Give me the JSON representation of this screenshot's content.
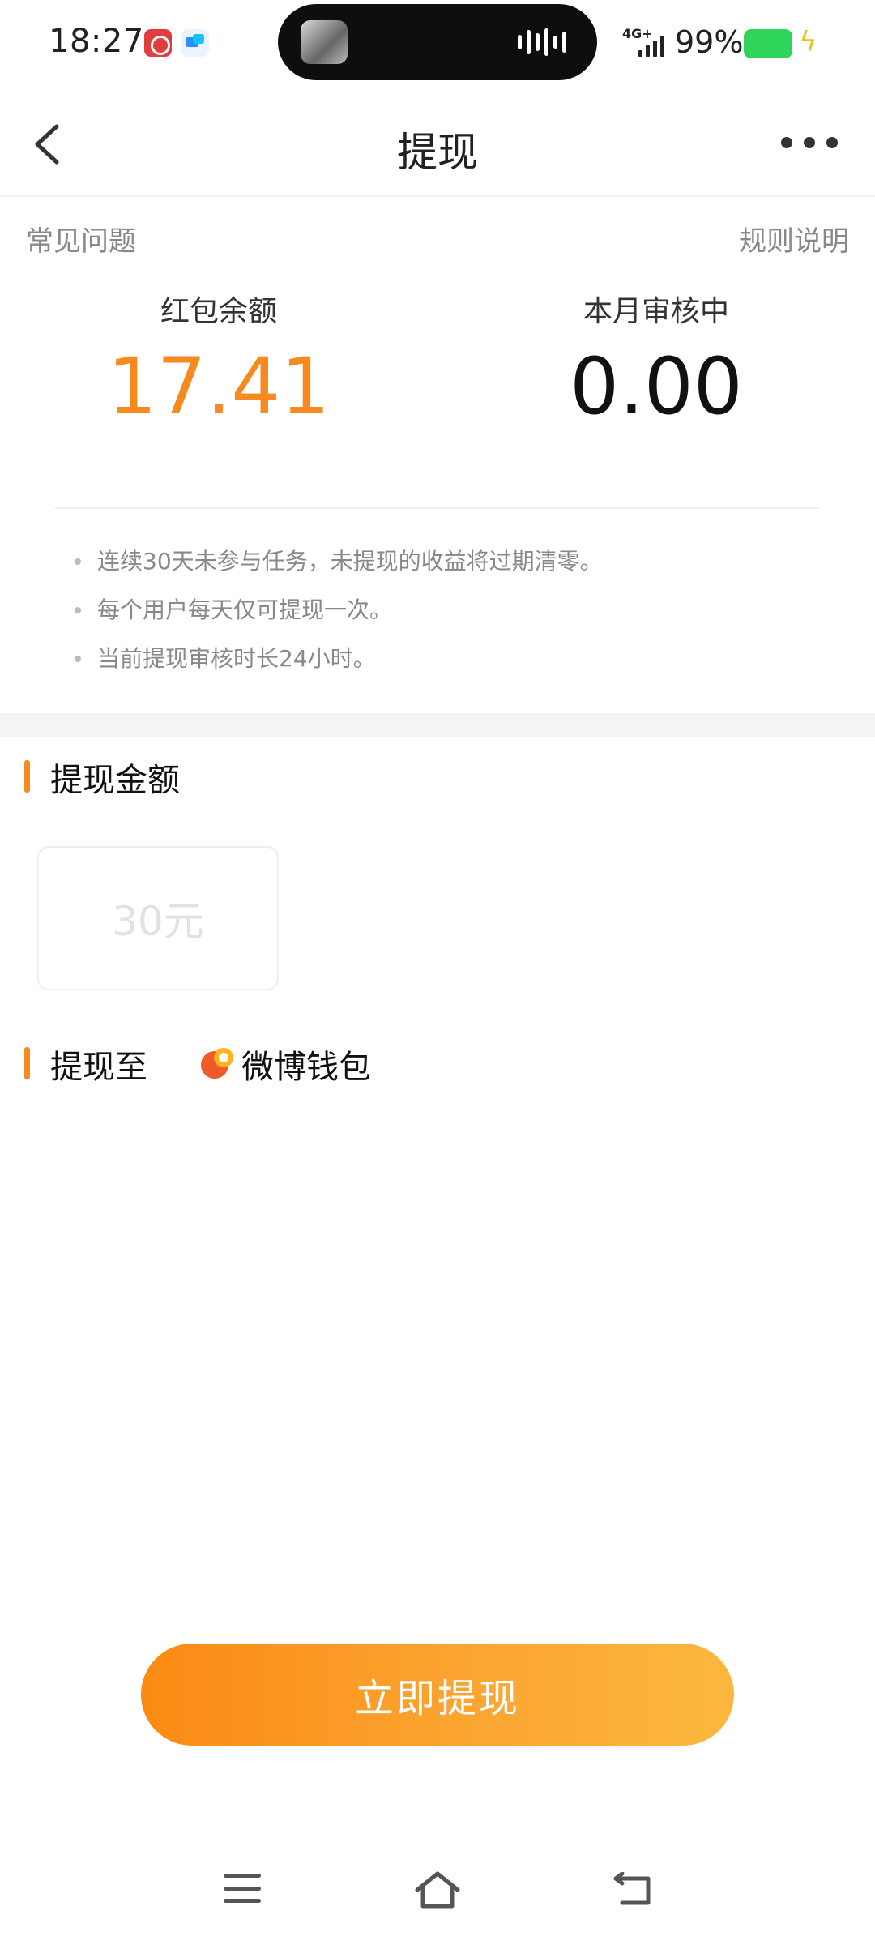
{
  "status_bar": {
    "time": "18:27",
    "network": "4G+",
    "battery": "99%",
    "icons": [
      "netease-music-icon",
      "message-app-icon",
      "audio-wave-icon",
      "signal-icon",
      "battery-icon",
      "charging-bolt-icon"
    ]
  },
  "header": {
    "title": "提现",
    "back_icon": "chevron-left-icon",
    "more_icon": "more-dots-icon"
  },
  "summary": {
    "faq_label": "常见问题",
    "rules_label": "规则说明",
    "balance_label": "红包余额",
    "balance_value": "17.41",
    "pending_label": "本月审核中",
    "pending_value": "0.00"
  },
  "notes": [
    "连续30天未参与任务，未提现的收益将过期清零。",
    "每个用户每天仅可提现一次。",
    "当前提现审核时长24小时。"
  ],
  "amount_section": {
    "title": "提现金额",
    "options": [
      "30元"
    ]
  },
  "destination": {
    "title": "提现至",
    "wallet_label": "微博钱包",
    "wallet_icon": "weibo-wallet-icon"
  },
  "action": {
    "button_label": "立即提现"
  },
  "colors": {
    "accent": "#f68a1e",
    "button_start": "#fb8a13",
    "button_end": "#fcb73f"
  }
}
